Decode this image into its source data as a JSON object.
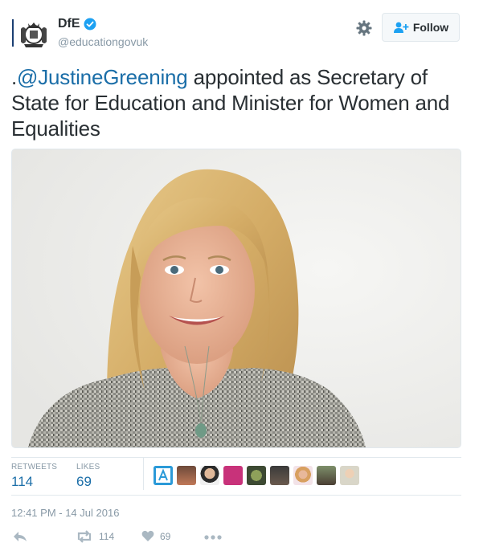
{
  "account": {
    "name": "DfE",
    "handle": "@educationgovuk",
    "verified": true
  },
  "header": {
    "follow_label": "Follow",
    "icons": [
      "crest-avatar",
      "verified-badge-icon",
      "gear-icon",
      "follow-person-icon"
    ]
  },
  "tweet": {
    "prefix": ".",
    "mention": "@JustineGreening",
    "text": " appointed as Secretary of State for Education and Minister for Women and Equalities"
  },
  "stats": {
    "retweets_label": "RETWEETS",
    "retweets_count": "114",
    "likes_label": "LIKES",
    "likes_count": "69"
  },
  "timestamp": "12:41 PM - 14 Jul 2016",
  "actions": {
    "reply_icon": "reply-icon",
    "retweet_icon": "retweet-icon",
    "retweet_count": "114",
    "like_icon": "heart-icon",
    "like_count": "69",
    "more_icon": "more-icon"
  },
  "colors": {
    "link": "#1b6ea8",
    "muted": "#8899a6",
    "text": "#292f33",
    "verified": "#1da1f2",
    "border": "#e1e8ed"
  }
}
